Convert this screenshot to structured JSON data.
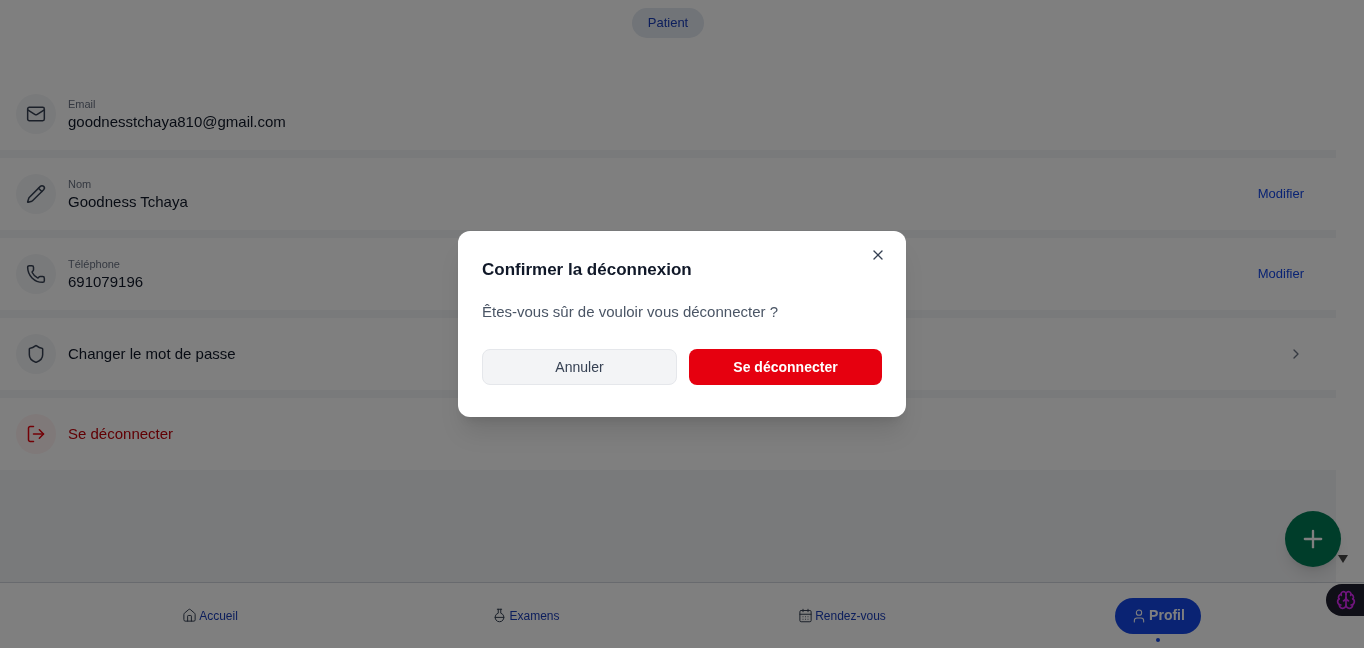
{
  "role_badge": "Patient",
  "profile_rows": [
    {
      "kind": "field",
      "label": "Email",
      "value": "goodnesstchaya810@gmail.com"
    },
    {
      "kind": "field",
      "label": "Nom",
      "value": "Goodness Tchaya",
      "action": "Modifier"
    },
    {
      "kind": "field",
      "label": "Téléphone",
      "value": "691079196",
      "action": "Modifier"
    },
    {
      "kind": "link",
      "value": "Changer le mot de passe"
    },
    {
      "kind": "danger",
      "value": "Se déconnecter"
    }
  ],
  "bottom_nav": [
    {
      "label": "Accueil",
      "selected": false
    },
    {
      "label": "Examens",
      "selected": false
    },
    {
      "label": "Rendez-vous",
      "selected": false
    },
    {
      "label": "Profil",
      "selected": true
    }
  ],
  "dialog": {
    "title": "Confirmer la déconnexion",
    "message": "Êtes-vous sûr de vouloir vous déconnecter ?",
    "cancel": "Annuler",
    "confirm": "Se déconnecter"
  }
}
